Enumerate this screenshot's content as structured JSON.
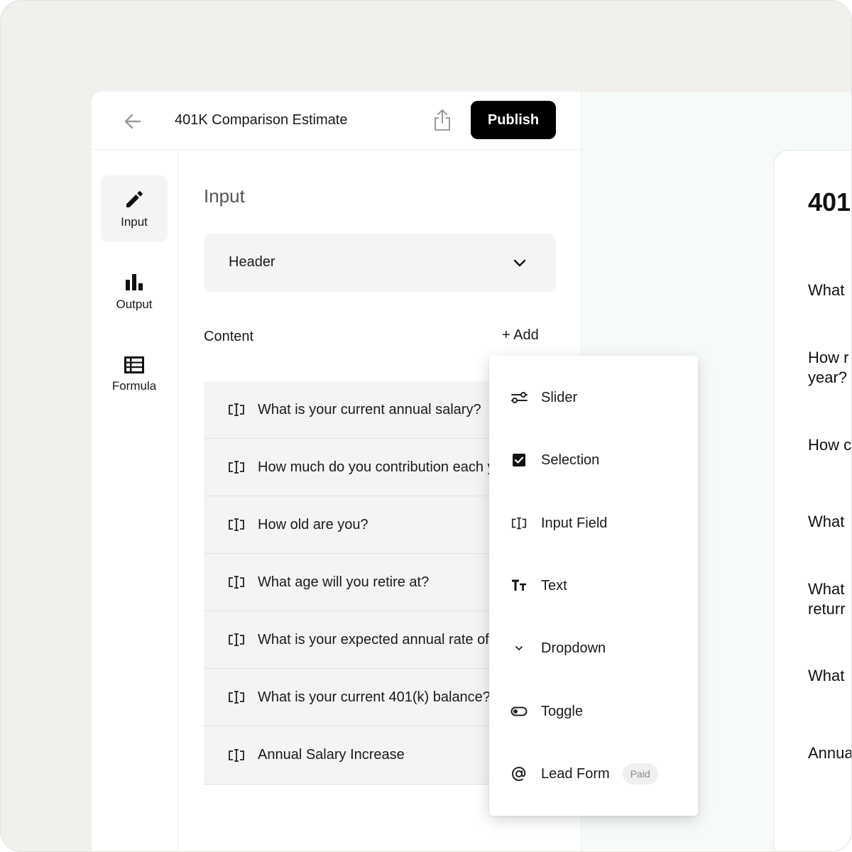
{
  "topbar": {
    "title": "401K Comparison Estimate",
    "publish_label": "Publish"
  },
  "rail": {
    "items": [
      {
        "label": "Input",
        "icon": "pencil-icon",
        "active": true
      },
      {
        "label": "Output",
        "icon": "bar-chart-icon",
        "active": false
      },
      {
        "label": "Formula",
        "icon": "table-icon",
        "active": false
      }
    ]
  },
  "editor": {
    "section_title": "Input",
    "header_select_value": "Header",
    "content_label": "Content",
    "add_label": "+ Add",
    "content_items": [
      "What is your current annual salary?",
      "How much do you contribution each year?",
      "How old are you?",
      "What age will you retire at?",
      "What is your expected annual rate of return?",
      "What is your current 401(k) balance?",
      "Annual Salary Increase"
    ]
  },
  "menu": {
    "items": [
      {
        "label": "Slider",
        "icon": "slider-icon"
      },
      {
        "label": "Selection",
        "icon": "checkbox-icon"
      },
      {
        "label": "Input Field",
        "icon": "input-field-icon"
      },
      {
        "label": "Text",
        "icon": "text-icon"
      },
      {
        "label": "Dropdown",
        "icon": "chevron-down-icon"
      },
      {
        "label": "Toggle",
        "icon": "toggle-icon"
      },
      {
        "label": "Lead Form",
        "icon": "at-sign-icon",
        "badge": "Paid"
      }
    ]
  },
  "preview": {
    "title": "401",
    "questions": [
      "What",
      "How r\nyear?",
      "How c",
      "What",
      "What\nreturr",
      "What",
      "Annua"
    ]
  },
  "colors": {
    "frame_bg": "#f1f0ed",
    "panel_bg": "#ffffff",
    "row_bg": "#f3f4f5",
    "publish_bg": "#000000",
    "preview_bg": "#f6fbf7"
  }
}
